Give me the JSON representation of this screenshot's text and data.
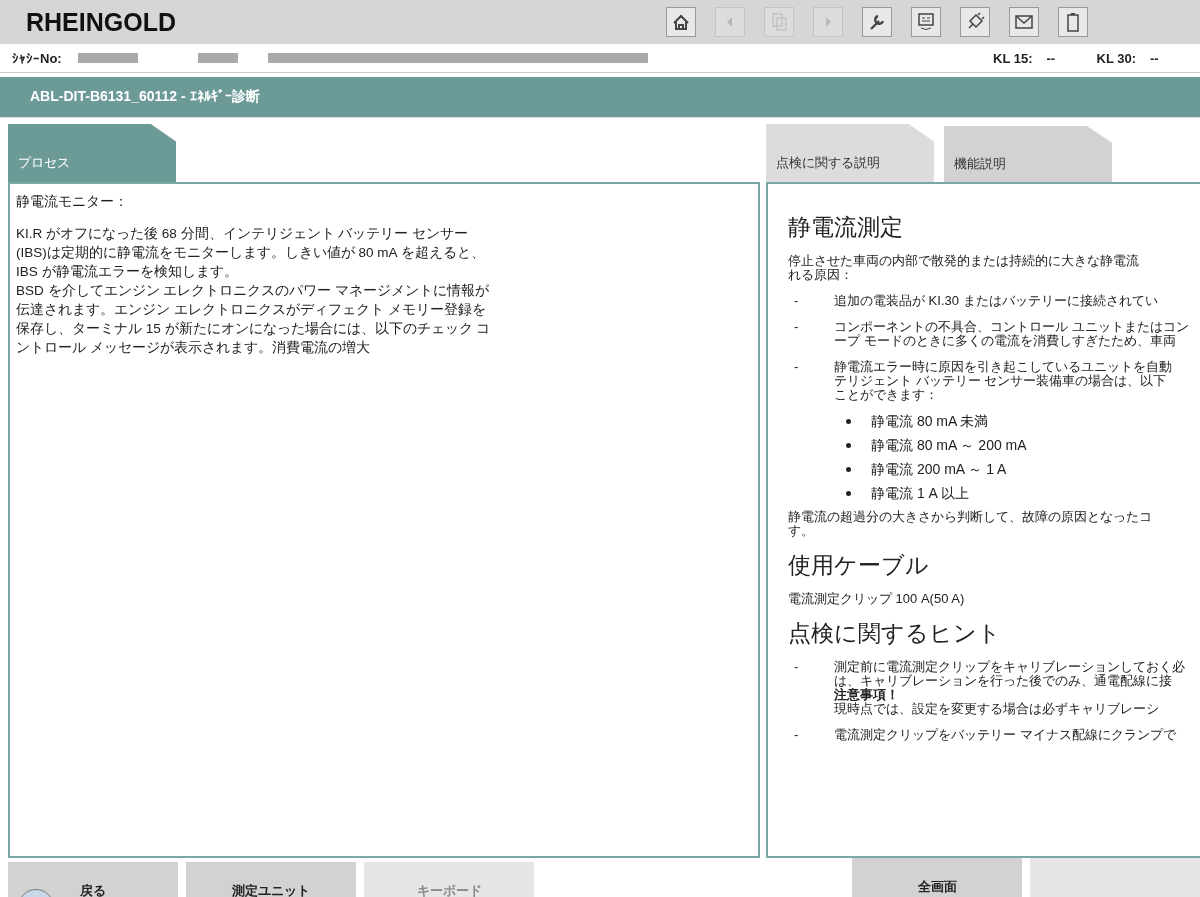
{
  "header": {
    "title": "RHEINGOLD",
    "toolbar": [
      {
        "kind": "home",
        "disabled": false
      },
      {
        "kind": "back",
        "disabled": true
      },
      {
        "kind": "docs",
        "disabled": true
      },
      {
        "kind": "forward",
        "disabled": true
      },
      {
        "kind": "wrench",
        "disabled": false
      },
      {
        "kind": "display",
        "disabled": false
      },
      {
        "kind": "plug",
        "disabled": false
      },
      {
        "kind": "mail",
        "disabled": false
      },
      {
        "kind": "battery",
        "disabled": false
      }
    ]
  },
  "vehicle_bar": {
    "chassis_label": "ｼｬｼｰNo:",
    "kl15_label": "KL 15:",
    "kl15_value": "--",
    "kl30_label": "KL 30:",
    "kl30_value": "--"
  },
  "title_bar": "ABL-DIT-B6131_60112  -  ｴﾈﾙｷﾞｰ診断",
  "left_tabs": [
    {
      "label": "プロセス",
      "selected": true
    }
  ],
  "left_panel": {
    "heading": "静電流モニター：",
    "paragraphs": [
      "KI.R がオフになった後 68 分間、インテリジェント バッテリー センサー (IBS)は定期的に静電流をモニターします。しきい値が 80 mA を超えると、IBS が静電流エラーを検知します。",
      "BSD を介してエンジン エレクトロニクスのパワー マネージメントに情報が伝達されます。エンジン エレクトロニクスがディフェクト メモリー登録を保存し、ターミナル 15 が新たにオンになった場合には、以下のチェック コントロール メッセージが表示されます。消費電流の増大"
    ]
  },
  "right_tabs": [
    {
      "label": "点検に関する説明",
      "selected": true
    },
    {
      "label": "機能説明",
      "selected": false
    }
  ],
  "right_panel": [
    {
      "kind": "h",
      "text": "静電流測定"
    },
    {
      "kind": "p",
      "lines": [
        "停止させた車両の内部で散発的または持続的に大きな静電流",
        "れる原因："
      ]
    },
    {
      "kind": "dash",
      "marker": "-",
      "lines": [
        "追加の電装品が KI.30 またはバッテリーに接続されてい"
      ]
    },
    {
      "kind": "dash",
      "marker": "-",
      "lines": [
        "コンポーネントの不具合、コントロール ユニットまたはコン",
        "ープ モードのときに多くの電流を消費しすぎたため、車両"
      ]
    },
    {
      "kind": "dash",
      "marker": "-",
      "lines": [
        "静電流エラー時に原因を引き起こしているユニットを自動",
        "テリジェント バッテリー センサー装備車の場合は、以下",
        "ことができます："
      ]
    },
    {
      "kind": "bullet",
      "lines": [
        "静電流 80 mA 未満"
      ]
    },
    {
      "kind": "bullet",
      "lines": [
        "静電流 80 mA ～ 200 mA"
      ]
    },
    {
      "kind": "bullet",
      "lines": [
        "静電流 200 mA ～ 1 A"
      ]
    },
    {
      "kind": "bullet",
      "lines": [
        "静電流 1 A 以上"
      ]
    },
    {
      "kind": "p",
      "lines": [
        "静電流の超過分の大きさから判断して、故障の原因となったコ",
        "す。"
      ]
    },
    {
      "kind": "h",
      "text": "使用ケーブル"
    },
    {
      "kind": "p",
      "lines": [
        "電流測定クリップ 100 A(50 A)"
      ]
    },
    {
      "kind": "h",
      "text": "点検に関するヒント"
    },
    {
      "kind": "dash",
      "marker": "-",
      "lines": [
        "測定前に電流測定クリップをキャリブレーションしておく必",
        "は、キャリブレーションを行った後でのみ、通電配線に接"
      ],
      "note_title": "注意事項！",
      "note": "現時点では、設定を変更する場合は必ずキャリブレーシ"
    },
    {
      "kind": "dash",
      "marker": "-",
      "lines": [
        "電流測定クリップをバッテリー マイナス配線にクランプで"
      ]
    }
  ],
  "buttons": [
    {
      "label": "戻る",
      "disabled": false,
      "icon": true
    },
    {
      "label": "測定ユニット",
      "disabled": false
    },
    {
      "label": "キーボード",
      "disabled": true
    }
  ],
  "right_buttons": [
    {
      "label": "全画面",
      "disabled": false
    },
    {
      "disabled": true
    }
  ]
}
